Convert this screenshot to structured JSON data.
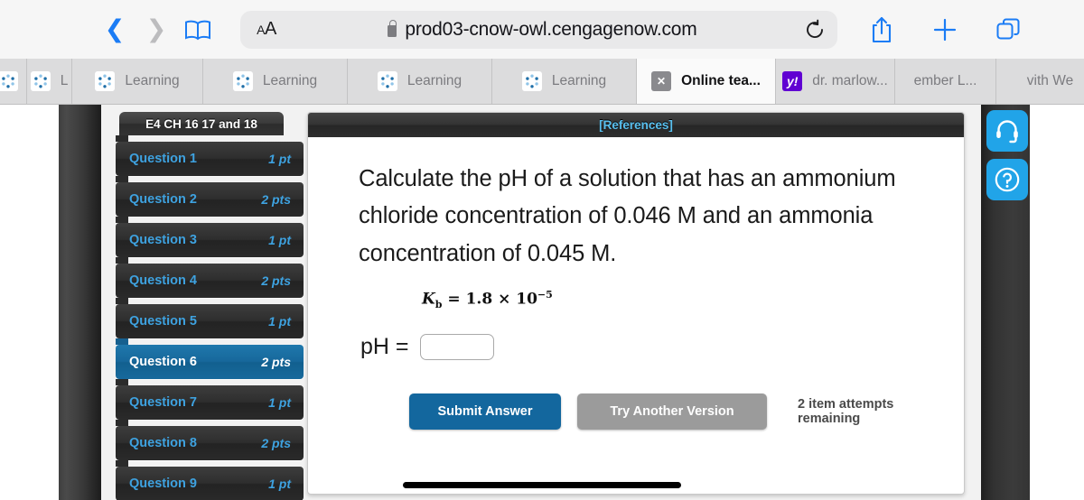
{
  "browser": {
    "url": "prod03-cnow-owl.cengagenow.com",
    "text_size_small": "A",
    "text_size_large": "A",
    "icons": {
      "back": "back-chevron-icon",
      "forward": "forward-chevron-icon",
      "bookmarks": "book-icon",
      "lock": "lock-icon",
      "reload": "reload-icon",
      "share": "share-icon",
      "new_tab": "plus-icon",
      "tabs": "tabs-icon"
    },
    "tabs": [
      {
        "label": "",
        "favicon": "learning-favicon",
        "active": false
      },
      {
        "label": "L",
        "favicon": "learning-favicon",
        "active": false
      },
      {
        "label": "Learning",
        "favicon": "learning-favicon",
        "active": false
      },
      {
        "label": "Learning",
        "favicon": "learning-favicon",
        "active": false
      },
      {
        "label": "Learning",
        "favicon": "learning-favicon",
        "active": false
      },
      {
        "label": "Learning",
        "favicon": "learning-favicon",
        "active": false
      },
      {
        "label": "Online tea...",
        "favicon": "x-favicon",
        "active": true
      },
      {
        "label": "dr. marlow...",
        "favicon": "yahoo-favicon",
        "active": false
      },
      {
        "label": "ember L...",
        "favicon": "none",
        "active": false
      },
      {
        "label": "vith We",
        "favicon": "none",
        "active": false
      }
    ]
  },
  "assignment": {
    "title": "E4 CH 16 17 and 18",
    "questions": [
      {
        "label": "Question 1",
        "points": "1 pt",
        "selected": false
      },
      {
        "label": "Question 2",
        "points": "2 pts",
        "selected": false
      },
      {
        "label": "Question 3",
        "points": "1 pt",
        "selected": false
      },
      {
        "label": "Question 4",
        "points": "2 pts",
        "selected": false
      },
      {
        "label": "Question 5",
        "points": "1 pt",
        "selected": false
      },
      {
        "label": "Question 6",
        "points": "2 pts",
        "selected": true
      },
      {
        "label": "Question 7",
        "points": "1 pt",
        "selected": false
      },
      {
        "label": "Question 8",
        "points": "2 pts",
        "selected": false
      },
      {
        "label": "Question 9",
        "points": "1 pt",
        "selected": false
      }
    ]
  },
  "question_card": {
    "references_link": "[References]",
    "prompt": "Calculate the pH of a solution that has an ammonium chloride concentration of 0.046 M and an ammonia concentration of 0.045 M.",
    "formula": {
      "symbol": "K",
      "subscript": "b",
      "equals": "=",
      "mantissa": "1.8",
      "times": "×",
      "base": "10",
      "exponent": "−5"
    },
    "answer_label": "pH =",
    "answer_value": "",
    "answer_placeholder": "",
    "submit_label": "Submit Answer",
    "try_another_label": "Try Another Version",
    "attempts_text": "2 item attempts remaining"
  },
  "floating": {
    "support_icon": "headset-icon",
    "help_icon": "question-mark-icon"
  },
  "colors": {
    "accent_blue": "#13679e",
    "link_blue": "#3ea2e0",
    "selected_tab": "#17699c",
    "gray_button": "#9b9b9b",
    "float_blue": "#21a4e8"
  }
}
